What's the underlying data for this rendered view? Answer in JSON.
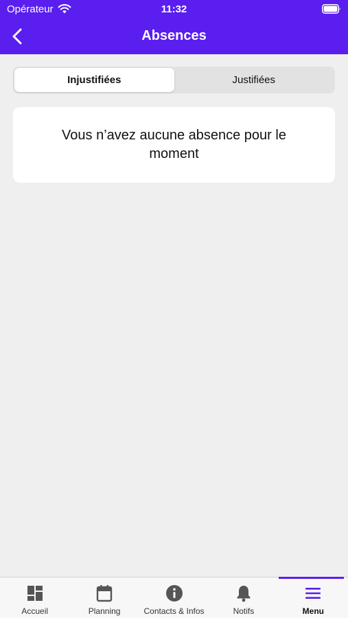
{
  "status_bar": {
    "carrier": "Opérateur",
    "time": "11:32"
  },
  "nav": {
    "title": "Absences"
  },
  "segments": [
    {
      "label": "Injustifiées",
      "selected": true
    },
    {
      "label": "Justifiées",
      "selected": false
    }
  ],
  "empty_state": {
    "message": "Vous n’avez aucune absence pour le moment"
  },
  "tab_bar": {
    "tabs": [
      {
        "label": "Accueil",
        "icon": "dashboard-icon"
      },
      {
        "label": "Planning",
        "icon": "calendar-icon"
      },
      {
        "label": "Contacts & Infos",
        "icon": "info-icon"
      },
      {
        "label": "Notifs",
        "icon": "bell-icon"
      },
      {
        "label": "Menu",
        "icon": "menu-icon",
        "active": true
      }
    ]
  },
  "colors": {
    "accent": "#5a1eee",
    "background": "#efefef",
    "card": "#ffffff"
  }
}
